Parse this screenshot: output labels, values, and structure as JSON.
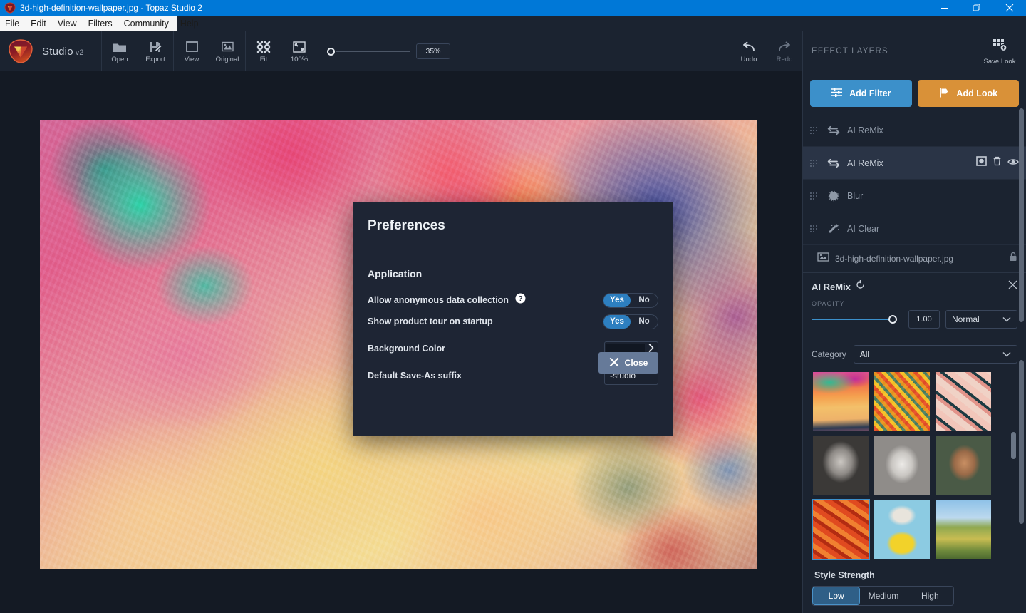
{
  "window": {
    "title": "3d-high-definition-wallpaper.jpg - Topaz Studio 2",
    "controls": {
      "minimize": "minimize-icon",
      "maximize": "restore-icon",
      "close": "close-icon"
    }
  },
  "menubar": {
    "items": [
      "File",
      "Edit",
      "View",
      "Filters",
      "Community",
      "Help"
    ]
  },
  "toolbar": {
    "brand": {
      "name": "Studio",
      "version": "v2"
    },
    "items": [
      {
        "label": "Open",
        "icon": "folder-icon",
        "dim": false
      },
      {
        "label": "Export",
        "icon": "export-icon",
        "dim": false
      },
      {
        "label": "View",
        "icon": "view-icon",
        "dim": false
      },
      {
        "label": "Original",
        "icon": "original-icon",
        "dim": false
      },
      {
        "label": "Fit",
        "icon": "fit-icon",
        "dim": false
      },
      {
        "label": "100%",
        "icon": "actual-size-icon",
        "dim": false
      }
    ],
    "zoom": {
      "value": "35%",
      "knob_position_pct": 0
    },
    "undo": {
      "label": "Undo",
      "icon": "undo-icon",
      "dim": false
    },
    "redo": {
      "label": "Redo",
      "icon": "redo-icon",
      "dim": true
    },
    "panel_title": "EFFECT LAYERS",
    "save_look": {
      "label": "Save Look",
      "icon": "save-look-icon"
    }
  },
  "right_panel": {
    "add_filter": {
      "label": "Add Filter",
      "icon": "sliders-icon",
      "color": "#3c90ca"
    },
    "add_look": {
      "label": "Add Look",
      "icon": "look-icon",
      "color": "#d99138"
    },
    "layers": [
      {
        "name": "AI ReMix",
        "icon": "remix-icon",
        "selected": false
      },
      {
        "name": "AI ReMix",
        "icon": "remix-icon",
        "selected": true,
        "actions": [
          "mask-icon",
          "trash-icon",
          "eye-icon"
        ]
      },
      {
        "name": "Blur",
        "icon": "blur-icon",
        "selected": false
      },
      {
        "name": "AI Clear",
        "icon": "ai-clear-icon",
        "selected": false
      }
    ],
    "base_layer": {
      "name": "3d-high-definition-wallpaper.jpg",
      "icon": "image-icon",
      "lock": "lock-icon"
    },
    "effect": {
      "title": "AI ReMix",
      "reset_icon": "reset-icon",
      "close_icon": "close-icon",
      "opacity_label": "OPACITY",
      "opacity_value": "1.00",
      "blend_mode": "Normal",
      "category_label": "Category",
      "category_value": "All",
      "thumbnails": [
        {
          "name": "sunset-style",
          "selected": false
        },
        {
          "name": "mosaic-style",
          "selected": false
        },
        {
          "name": "chains-style",
          "selected": false
        },
        {
          "name": "portrait-style",
          "selected": false
        },
        {
          "name": "sketch-style",
          "selected": false
        },
        {
          "name": "vangogh-style",
          "selected": false
        },
        {
          "name": "autumn-style",
          "selected": true
        },
        {
          "name": "popart-style",
          "selected": false
        },
        {
          "name": "landscape-style",
          "selected": false
        }
      ],
      "style_strength_label": "Style Strength",
      "style_strength_options": [
        "Low",
        "Medium",
        "High"
      ],
      "style_strength_selected": "Low"
    }
  },
  "dialog": {
    "title": "Preferences",
    "section_title": "Application",
    "rows": [
      {
        "label": "Allow anonymous data collection",
        "type": "toggle",
        "help": true,
        "options": [
          "Yes",
          "No"
        ],
        "value": "Yes"
      },
      {
        "label": "Show product tour on startup",
        "type": "toggle",
        "help": false,
        "options": [
          "Yes",
          "No"
        ],
        "value": "Yes"
      },
      {
        "label": "Background Color",
        "type": "color",
        "value": "#111722"
      },
      {
        "label": "Default Save-As suffix",
        "type": "text",
        "value": "-studio"
      }
    ],
    "close_button": {
      "label": "Close",
      "icon": "close-x-icon"
    }
  }
}
